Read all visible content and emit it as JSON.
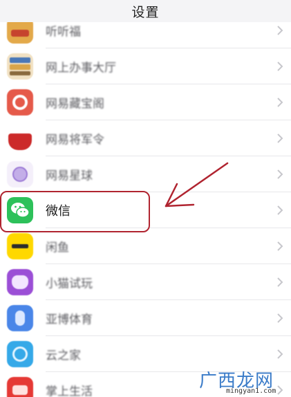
{
  "nav": {
    "title": "设置"
  },
  "rows": [
    {
      "label": "听听福",
      "icon": "app-icon-partial",
      "color": "#d9902f"
    },
    {
      "label": "网上办事大厅",
      "icon": "app-icon-gov",
      "color": "#c99a52"
    },
    {
      "label": "网易藏宝阁",
      "icon": "app-icon-treasure",
      "color": "#e0574a"
    },
    {
      "label": "网易将军令",
      "icon": "app-icon-token",
      "color": "#cc2a2a"
    },
    {
      "label": "网易星球",
      "icon": "app-icon-planet",
      "color": "#b79be0"
    },
    {
      "label": "微信",
      "icon": "wechat-icon",
      "color": "#2dc15a"
    },
    {
      "label": "闲鱼",
      "icon": "app-icon-xianyu",
      "color": "#ffd800"
    },
    {
      "label": "小猫试玩",
      "icon": "app-icon-cat",
      "color": "#9b4fd6"
    },
    {
      "label": "亚博体育",
      "icon": "app-icon-sports",
      "color": "#4a86e8"
    },
    {
      "label": "云之家",
      "icon": "app-icon-cloud",
      "color": "#35a9e8"
    },
    {
      "label": "掌上生活",
      "icon": "app-icon-life",
      "color": "#e53935"
    }
  ],
  "annotation": {
    "highlight_color": "#b02430"
  },
  "watermark": {
    "text": "广西龙网",
    "url": "mingyan1.com"
  }
}
